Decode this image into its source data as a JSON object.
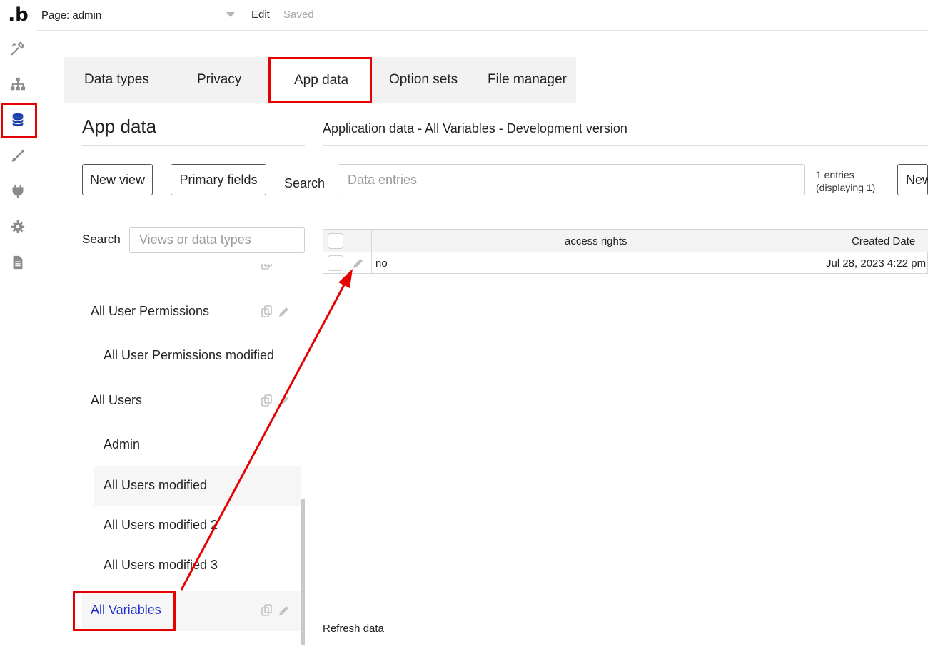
{
  "brand": {
    "logo_text": ".b"
  },
  "rail": {
    "items": [
      {
        "name": "design-icon"
      },
      {
        "name": "workflow-icon"
      },
      {
        "name": "data-icon",
        "active": true
      },
      {
        "name": "styles-icon"
      },
      {
        "name": "plugins-icon"
      },
      {
        "name": "settings-icon"
      },
      {
        "name": "logs-icon"
      }
    ]
  },
  "topbar": {
    "page_label": "Page: admin",
    "edit_label": "Edit",
    "saved_label": "Saved"
  },
  "tabs": [
    {
      "label": "Data types"
    },
    {
      "label": "Privacy"
    },
    {
      "label": "App data",
      "active": true
    },
    {
      "label": "Option sets"
    },
    {
      "label": "File manager"
    }
  ],
  "left": {
    "title": "App data",
    "new_view_label": "New view",
    "primary_fields_label": "Primary fields",
    "search_label": "Search",
    "search_placeholder": "Views or data types",
    "views": [
      {
        "label": "All User Permissions",
        "level": 0
      },
      {
        "label": "All User Permissions modified",
        "level": 1
      },
      {
        "label": "All Users",
        "level": 0
      },
      {
        "label": "Admin",
        "level": 1
      },
      {
        "label": "All Users modified",
        "level": 1
      },
      {
        "label": "All Users modified 2",
        "level": 1
      },
      {
        "label": "All Users modified 3",
        "level": 1
      },
      {
        "label": "All Variables",
        "level": 0,
        "selected": true
      }
    ]
  },
  "right": {
    "title": "Application data - All Variables - Development version",
    "search_label": "Search",
    "search_placeholder": "Data entries",
    "entries_line1": "1 entries",
    "entries_line2": "(displaying 1)",
    "new_entry_label": "New",
    "columns": [
      "access rights",
      "Created Date"
    ],
    "rows": [
      {
        "access_rights": "no",
        "created_date": "Jul 28, 2023 4:22 pm"
      }
    ],
    "refresh_label": "Refresh data"
  },
  "colors": {
    "accent_active": "#1a3fa8",
    "annotation_red": "#e60000",
    "selected_link": "#2233cc"
  }
}
